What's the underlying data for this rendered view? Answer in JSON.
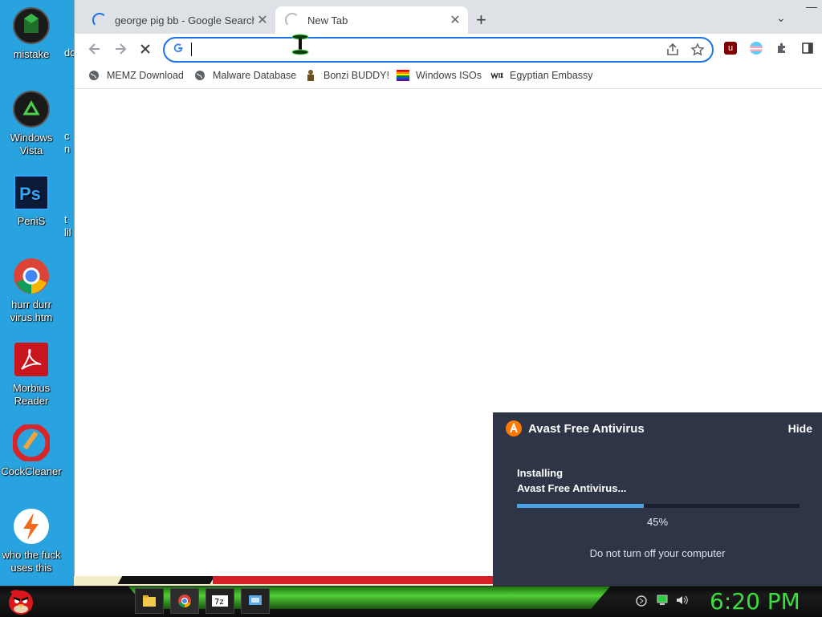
{
  "desktop": {
    "icons": [
      {
        "label_lines": [
          "mistake"
        ],
        "icon": "app-icon-green-cube"
      },
      {
        "label_lines": [
          "Windows",
          "Vista"
        ],
        "icon": "recycle-bin-icon"
      },
      {
        "label_lines": [
          "PeniS"
        ],
        "icon": "photoshop-icon"
      },
      {
        "label_lines": [
          "hurr durr",
          "virus.htm"
        ],
        "icon": "chrome-icon"
      },
      {
        "label_lines": [
          "Morbius",
          "Reader"
        ],
        "icon": "pdf-reader-icon"
      },
      {
        "label_lines": [
          "CockCleaner"
        ],
        "icon": "ccleaner-icon"
      },
      {
        "label_lines": [
          "who the fuck",
          "uses this"
        ],
        "icon": "lightning-icon"
      }
    ],
    "partial_icons": [
      {
        "text": "do"
      },
      {
        "text": "c\nn"
      },
      {
        "text": "t\nlil"
      }
    ]
  },
  "browser": {
    "tabs": [
      {
        "title": "george pig bb - Google Search",
        "active": false,
        "icon": "loading-spinner-icon"
      },
      {
        "title": "New Tab",
        "active": true,
        "icon": "loading-spinner-icon"
      }
    ],
    "new_tab_symbol": "+",
    "tab_list_symbol": "⌄",
    "close_symbol": "✕",
    "minimize_symbol": "—",
    "omnibox": {
      "value": "",
      "placeholder": "",
      "icon": "google-icon"
    },
    "extensions": [
      "ublock-origin-icon",
      "trans-flag-icon",
      "puzzle-extensions-icon",
      "side-panel-icon"
    ],
    "bookmarks": [
      {
        "label": "MEMZ Download",
        "icon": "globe-icon"
      },
      {
        "label": "Malware Database",
        "icon": "globe-icon"
      },
      {
        "label": "Bonzi BUDDY!",
        "icon": "bonzi-icon"
      },
      {
        "label": "Windows ISOs",
        "icon": "rainbow-flag-icon"
      },
      {
        "label": "Egyptian Embassy",
        "icon": "wix-icon"
      }
    ]
  },
  "avast": {
    "title": "Avast Free Antivirus",
    "hide_label": "Hide",
    "status_line1": "Installing",
    "status_line2": "Avast Free Antivirus...",
    "progress": 45,
    "progress_label": "45%",
    "warning": "Do not turn off your computer",
    "colors": {
      "bg": "#2e3547",
      "accent": "#ff7800",
      "progress": "#4aa3e6"
    }
  },
  "taskbar": {
    "start_icon": "angry-bird-start-icon",
    "pinned": [
      "file-explorer-icon",
      "chrome-icon",
      "7zip-icon",
      "control-panel-icon"
    ],
    "tray": [
      "network-icon",
      "monitor-icon",
      "volume-icon"
    ],
    "clock": "6:20 PM",
    "clock_color": "#39e03a"
  }
}
